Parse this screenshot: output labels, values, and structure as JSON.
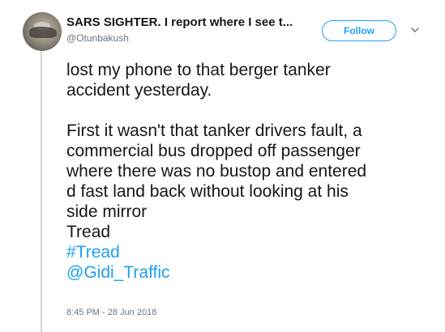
{
  "author": {
    "display_name": "SARS SIGHTER. I report where I see t...",
    "handle": "@Otunbakush"
  },
  "follow_label": "Follow",
  "tweet": {
    "lines": [
      "lost my phone to that berger tanker",
      "accident yesterday.",
      "First it wasn't that tanker drivers fault, a",
      "commercial bus dropped off passenger",
      "where there was no bustop and entered",
      "d fast land back without looking at his",
      "side mirror",
      "Tread"
    ],
    "hashtag": "#Tread",
    "mention": "@Gidi_Traffic"
  },
  "timestamp": "8:45 PM - 28 Jun 2018",
  "colors": {
    "accent": "#1da1f2",
    "muted": "#657786",
    "text": "#14171a",
    "thread_line": "#cfd9de"
  },
  "icons": {
    "more": "chevron-down-icon"
  }
}
